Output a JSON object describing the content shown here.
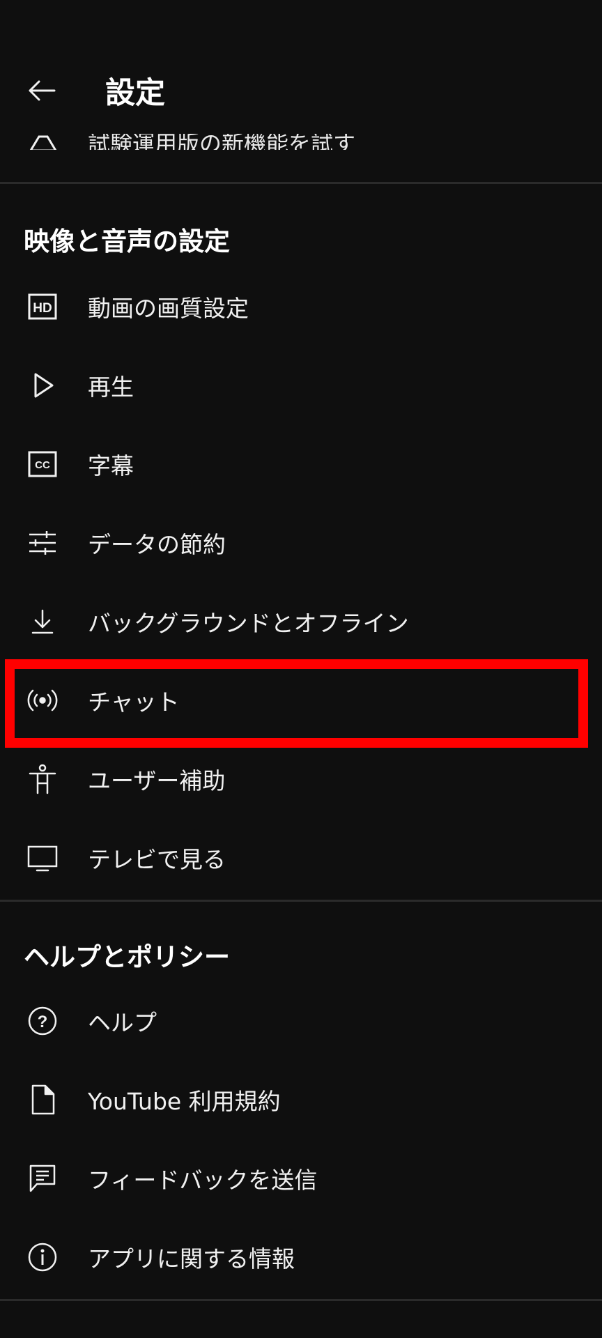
{
  "header": {
    "title": "設定",
    "back_icon": "arrow-left-icon"
  },
  "peek_item": {
    "label": "試験運用版の新機能を試す",
    "icon": "flask-icon"
  },
  "sections": [
    {
      "title": "映像と音声の設定",
      "items": [
        {
          "label": "動画の画質設定",
          "icon": "hd-icon"
        },
        {
          "label": "再生",
          "icon": "play-icon"
        },
        {
          "label": "字幕",
          "icon": "closed-captions-icon"
        },
        {
          "label": "データの節約",
          "icon": "sliders-icon"
        },
        {
          "label": "バックグラウンドとオフライン",
          "icon": "download-icon"
        },
        {
          "label": "チャット",
          "icon": "live-broadcast-icon"
        },
        {
          "label": "ユーザー補助",
          "icon": "accessibility-icon"
        },
        {
          "label": "テレビで見る",
          "icon": "tv-icon"
        }
      ]
    },
    {
      "title": "ヘルプとポリシー",
      "items": [
        {
          "label": "ヘルプ",
          "icon": "help-circle-icon"
        },
        {
          "label": "YouTube 利用規約",
          "icon": "document-icon"
        },
        {
          "label": "フィードバックを送信",
          "icon": "feedback-icon"
        },
        {
          "label": "アプリに関する情報",
          "icon": "info-icon"
        }
      ]
    }
  ],
  "colors": {
    "background": "#0f0f0f",
    "text": "#f1f1f1",
    "divider": "#2b2b2b",
    "highlight": "#ff0000"
  }
}
